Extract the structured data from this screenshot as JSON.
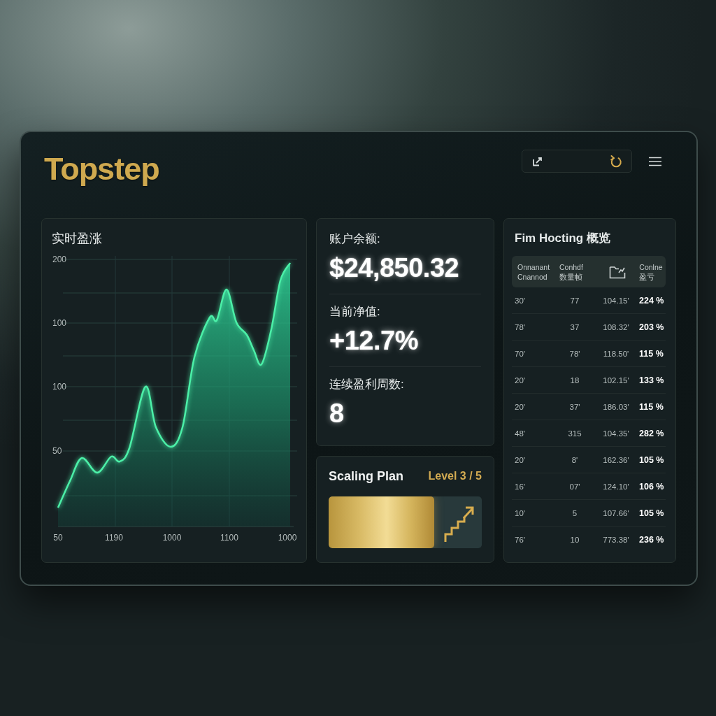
{
  "header": {
    "logo": "Topstep"
  },
  "pnl_chart": {
    "title": "实时盈涨",
    "y_labels": [
      "200",
      "100",
      "100",
      "50"
    ],
    "x_labels": [
      "50",
      "1190",
      "1000",
      "1100",
      "1000"
    ]
  },
  "account": {
    "metrics": [
      {
        "label": "账户余额:",
        "value": "$24,850.32"
      },
      {
        "label": "当前净值:",
        "value": "+12.7%"
      },
      {
        "label": "连续盈利周数:",
        "value": "8"
      }
    ]
  },
  "scaling_plan": {
    "title": "Scaling Plan",
    "level_text": "Level 3 / 5",
    "level": 0.69
  },
  "table": {
    "title": "Fim Hocting 概览",
    "columns": [
      {
        "kind": "text",
        "lines": [
          "Onnanant",
          "Cnannod"
        ]
      },
      {
        "kind": "text",
        "lines": [
          "Conhdf",
          "数量帧"
        ]
      },
      {
        "kind": "icon"
      },
      {
        "kind": "text",
        "lines": [
          "Conlne",
          "盈亏"
        ]
      }
    ],
    "rows": [
      [
        "30'",
        "77",
        "104.15'",
        "224 %"
      ],
      [
        "78'",
        "37",
        "108.32'",
        "203 %"
      ],
      [
        "70'",
        "78'",
        "118.50'",
        "115 %"
      ],
      [
        "20'",
        "18",
        "102.15'",
        "133 %"
      ],
      [
        "20'",
        "37'",
        "186.03'",
        "115 %"
      ],
      [
        "48'",
        "315",
        "104.35'",
        "282 %"
      ],
      [
        "20'",
        "8'",
        "162.36'",
        "105 %"
      ],
      [
        "16'",
        "07'",
        "124.10'",
        "106 %"
      ],
      [
        "10'",
        "5",
        "107.66'",
        "105 %"
      ],
      [
        "76'",
        "10",
        "773.38'",
        "236 %"
      ]
    ]
  }
}
